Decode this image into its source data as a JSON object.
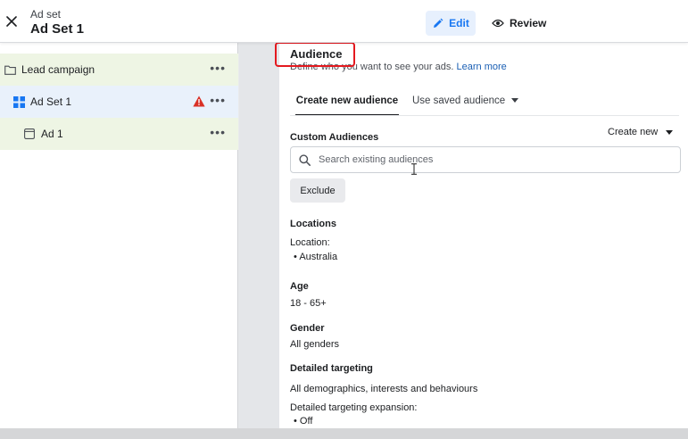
{
  "header": {
    "subtitle": "Ad set",
    "title": "Ad Set 1",
    "edit_label": "Edit",
    "review_label": "Review"
  },
  "tree": {
    "campaign": {
      "label": "Lead campaign",
      "more": "•••"
    },
    "adset": {
      "label": "Ad Set 1",
      "more": "•••",
      "status": "warning"
    },
    "ad": {
      "label": "Ad 1",
      "more": "•••"
    }
  },
  "audience": {
    "title": "Audience",
    "description": "Define who you want to see your ads.",
    "learn_more": "Learn more",
    "tabs": {
      "create": "Create new audience",
      "saved": "Use saved audience"
    },
    "custom_audiences": {
      "label": "Custom Audiences",
      "create_new": "Create new",
      "search_placeholder": "Search existing audiences",
      "exclude_label": "Exclude"
    },
    "locations": {
      "label": "Locations",
      "sub_label": "Location:",
      "items": [
        "Australia"
      ]
    },
    "age": {
      "label": "Age",
      "value": "18 - 65+"
    },
    "gender": {
      "label": "Gender",
      "value": "All genders"
    },
    "detailed_targeting": {
      "label": "Detailed targeting",
      "value": "All demographics, interests and behaviours",
      "expansion_label": "Detailed targeting expansion:",
      "expansion_value": "Off"
    }
  },
  "colors": {
    "accent": "#1877f2",
    "highlight_box": "#e4191f",
    "warning": "#d93025",
    "campaign_row_bg": "#eef5e4",
    "adset_row_bg": "#e9f1fb"
  }
}
